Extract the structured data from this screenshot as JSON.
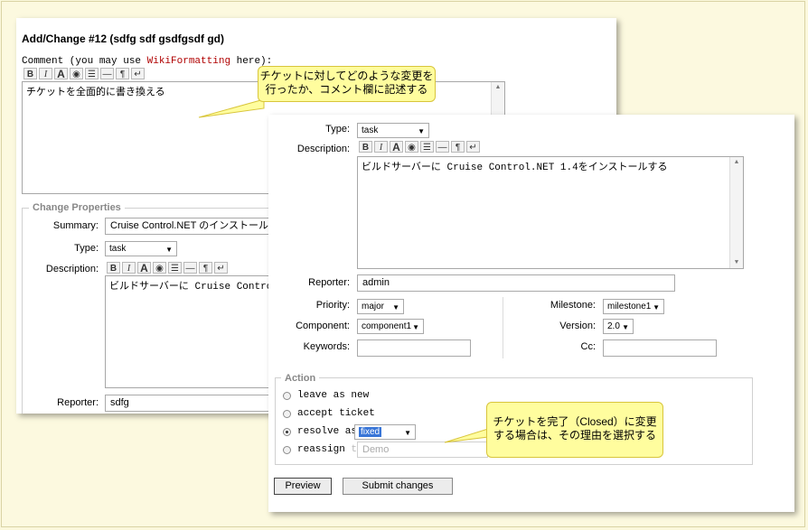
{
  "back": {
    "title": "Add/Change #12 (sdfg sdf gsdfgsdf gd)",
    "comment_prefix": "Comment (you may use ",
    "comment_link": "WikiFormatting",
    "comment_suffix": " here):",
    "comment_text": "チケットを全面的に書き換える",
    "legend": "Change Properties",
    "summary_label": "Summary:",
    "summary_value": "Cruise Control.NET のインストール",
    "type_label": "Type:",
    "type_value": "task",
    "description_label": "Description:",
    "description_text": "ビルドサーバーに Cruise Control.",
    "reporter_label": "Reporter:",
    "reporter_value": "sdfg"
  },
  "toolbar_glyphs": [
    "B",
    "I",
    "A",
    "◉",
    "☰",
    "—",
    "¶",
    "↵"
  ],
  "front": {
    "type_label": "Type:",
    "type_value": "task",
    "description_label": "Description:",
    "description_text": "ビルドサーバーに Cruise Control.NET 1.4をインストールする",
    "reporter_label": "Reporter:",
    "reporter_value": "admin",
    "priority_label": "Priority:",
    "priority_value": "major",
    "milestone_label": "Milestone:",
    "milestone_value": "milestone1",
    "component_label": "Component:",
    "component_value": "component1",
    "version_label": "Version:",
    "version_value": "2.0",
    "keywords_label": "Keywords:",
    "cc_label": "Cc:",
    "action_legend": "Action",
    "actions": {
      "leave": "leave as new",
      "accept": "accept ticket",
      "resolve": "resolve as:",
      "resolve_value": "fixed",
      "reassign": "reassign",
      "reassign_to": "to:",
      "reassign_value": "Demo"
    },
    "preview_button": "Preview",
    "submit_button": "Submit changes"
  },
  "callouts": {
    "comment_line1": "チケットに対してどのような変更を",
    "comment_line2": "行ったか、コメント欄に記述する",
    "resolve_line1": "チケットを完了（Closed）に変更",
    "resolve_line2": "する場合は、その理由を選択する"
  },
  "colors": {
    "link": "#b00000",
    "callout": "#fffd9e",
    "selected": "#3875d7"
  }
}
